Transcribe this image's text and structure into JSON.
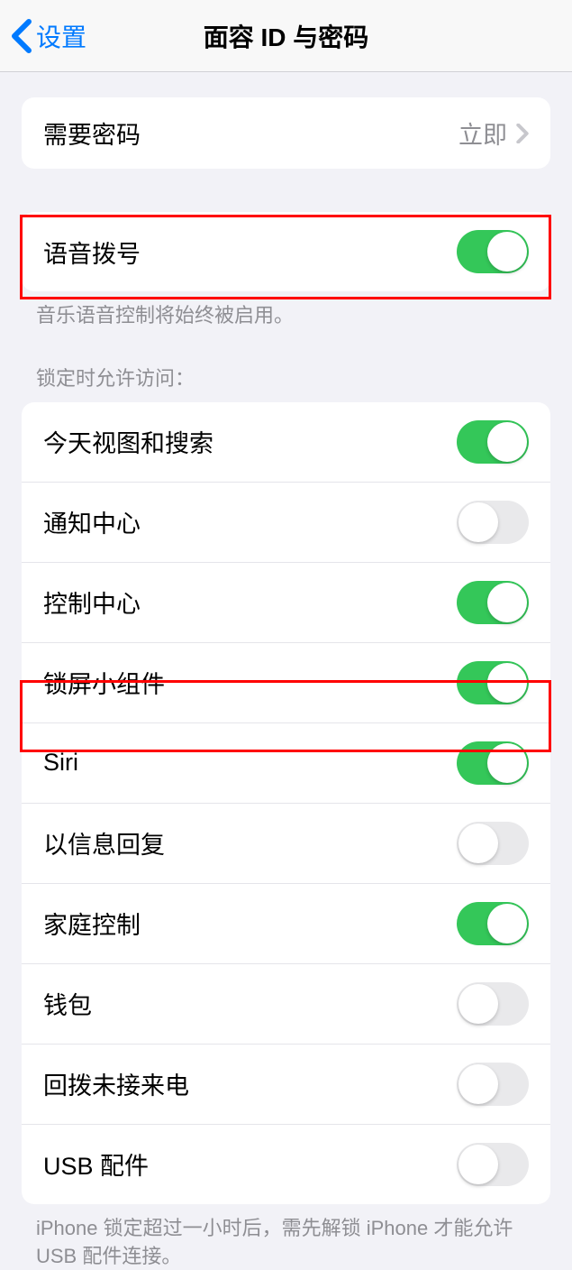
{
  "nav": {
    "back_label": "设置",
    "title": "面容 ID 与密码"
  },
  "passcode": {
    "require_label": "需要密码",
    "require_value": "立即"
  },
  "voice_dial": {
    "label": "语音拨号",
    "enabled": true,
    "footer": "音乐语音控制将始终被启用。"
  },
  "lock_access": {
    "header": "锁定时允许访问：",
    "items": [
      {
        "label": "今天视图和搜索",
        "enabled": true
      },
      {
        "label": "通知中心",
        "enabled": false
      },
      {
        "label": "控制中心",
        "enabled": true
      },
      {
        "label": "锁屏小组件",
        "enabled": true
      },
      {
        "label": "Siri",
        "enabled": true
      },
      {
        "label": "以信息回复",
        "enabled": false
      },
      {
        "label": "家庭控制",
        "enabled": true
      },
      {
        "label": "钱包",
        "enabled": false
      },
      {
        "label": "回拨未接来电",
        "enabled": false
      },
      {
        "label": "USB 配件",
        "enabled": false
      }
    ],
    "footer": "iPhone 锁定超过一小时后，需先解锁 iPhone 才能允许 USB 配件连接。"
  }
}
